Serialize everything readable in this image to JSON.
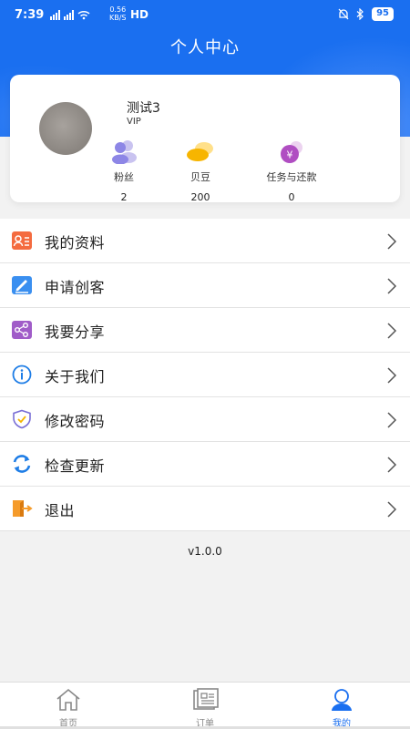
{
  "status": {
    "time": "7:39",
    "net_speed": "0.56",
    "net_unit": "KB/S",
    "hd": "HD",
    "battery": "95"
  },
  "header": {
    "title": "个人中心"
  },
  "profile": {
    "name": "测试3",
    "level": "VIP",
    "stats": [
      {
        "label": "粉丝",
        "value": "2"
      },
      {
        "label": "贝豆",
        "value": "200"
      },
      {
        "label": "任务与还款",
        "value": "0"
      }
    ]
  },
  "menu": [
    {
      "label": "我的资料",
      "icon": "profile-card-icon"
    },
    {
      "label": "申请创客",
      "icon": "edit-pen-icon"
    },
    {
      "label": "我要分享",
      "icon": "share-icon"
    },
    {
      "label": "关于我们",
      "icon": "info-icon"
    },
    {
      "label": "修改密码",
      "icon": "shield-check-icon"
    },
    {
      "label": "检查更新",
      "icon": "refresh-icon"
    },
    {
      "label": "退出",
      "icon": "logout-icon"
    }
  ],
  "version": "v1.0.0",
  "tabs": [
    {
      "label": "首页",
      "icon": "home-icon"
    },
    {
      "label": "订单",
      "icon": "order-icon"
    },
    {
      "label": "我的",
      "icon": "user-icon",
      "active": true
    }
  ],
  "colors": {
    "primary": "#1a6ff0",
    "background": "#f2f2f2"
  }
}
